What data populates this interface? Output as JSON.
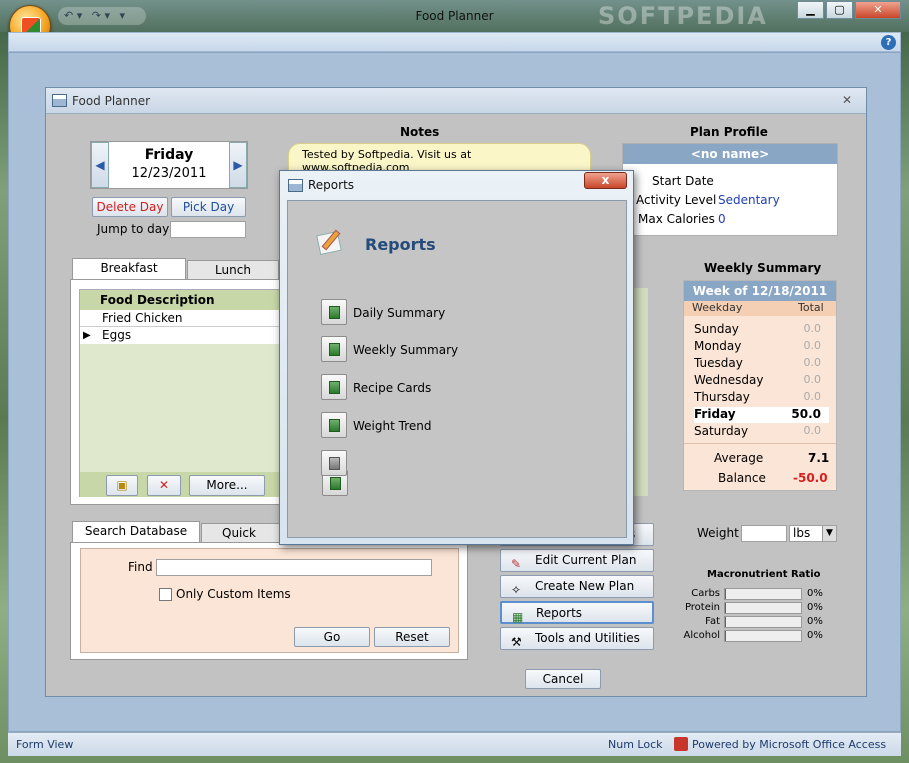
{
  "window": {
    "title": "Food Planner",
    "watermark": "SOFTPEDIA"
  },
  "form": {
    "title": "Food Planner"
  },
  "day_nav": {
    "day": "Friday",
    "date": "12/23/2011",
    "prev": "◀",
    "next": "▶",
    "delete_label": "Delete Day",
    "pick_label": "Pick Day",
    "jump_label": "Jump to day"
  },
  "notes": {
    "title": "Notes",
    "text": "Tested by Softpedia. Visit us at www.softpedia.com"
  },
  "plan_profile": {
    "title": "Plan Profile",
    "name": "<no name>",
    "start_date_label": "Start Date",
    "activity_label": "Activity Level",
    "activity_value": "Sedentary",
    "max_cal_label": "Max Calories",
    "max_cal_value": "0"
  },
  "meal_tabs": [
    "Breakfast",
    "Lunch"
  ],
  "food_table": {
    "header": "Food Description",
    "rows": [
      "Fried Chicken",
      "Eggs"
    ],
    "more_label": "More..."
  },
  "weekly": {
    "title": "Weekly Summary",
    "week_of": "Week of  12/18/2011",
    "col_day": "Weekday",
    "col_total": "Total",
    "days": [
      {
        "name": "Sunday",
        "total": "0.0"
      },
      {
        "name": "Monday",
        "total": "0.0"
      },
      {
        "name": "Tuesday",
        "total": "0.0"
      },
      {
        "name": "Wednesday",
        "total": "0.0"
      },
      {
        "name": "Thursday",
        "total": "0.0"
      },
      {
        "name": "Friday",
        "total": "50.0"
      },
      {
        "name": "Saturday",
        "total": "0.0"
      }
    ],
    "average_label": "Average",
    "average_value": "7.1",
    "balance_label": "Balance",
    "balance_value": "-50.0"
  },
  "search": {
    "tabs": [
      "Search Database",
      "Quick Add"
    ],
    "find_label": "Find",
    "custom_label": "Only Custom Items",
    "go_label": "Go",
    "reset_label": "Reset"
  },
  "weight": {
    "label": "Weight",
    "unit": "lbs"
  },
  "nav_buttons": {
    "edit": "Edit Current Plan",
    "create": "Create New Plan",
    "reports": "Reports",
    "tools": "Tools and Utilities",
    "partial": "s"
  },
  "macros": {
    "title": "Macronutrient Ratio",
    "rows": [
      {
        "name": "Carbs",
        "pct": "0%",
        "fill": 0
      },
      {
        "name": "Protein",
        "pct": "0%",
        "fill": 0
      },
      {
        "name": "Fat",
        "pct": "0%",
        "fill": 0
      },
      {
        "name": "Alcohol",
        "pct": "0%",
        "fill": 0
      }
    ]
  },
  "dialog": {
    "title": "Reports",
    "heading": "Reports",
    "close": "x",
    "items": [
      "Daily Summary",
      "Weekly Summary",
      "Recipe Cards",
      "Weight Trend"
    ],
    "cancel_label": "Cancel"
  },
  "status": {
    "left": "Form View",
    "numlock": "Num Lock",
    "powered": "Powered by Microsoft Office Access"
  }
}
